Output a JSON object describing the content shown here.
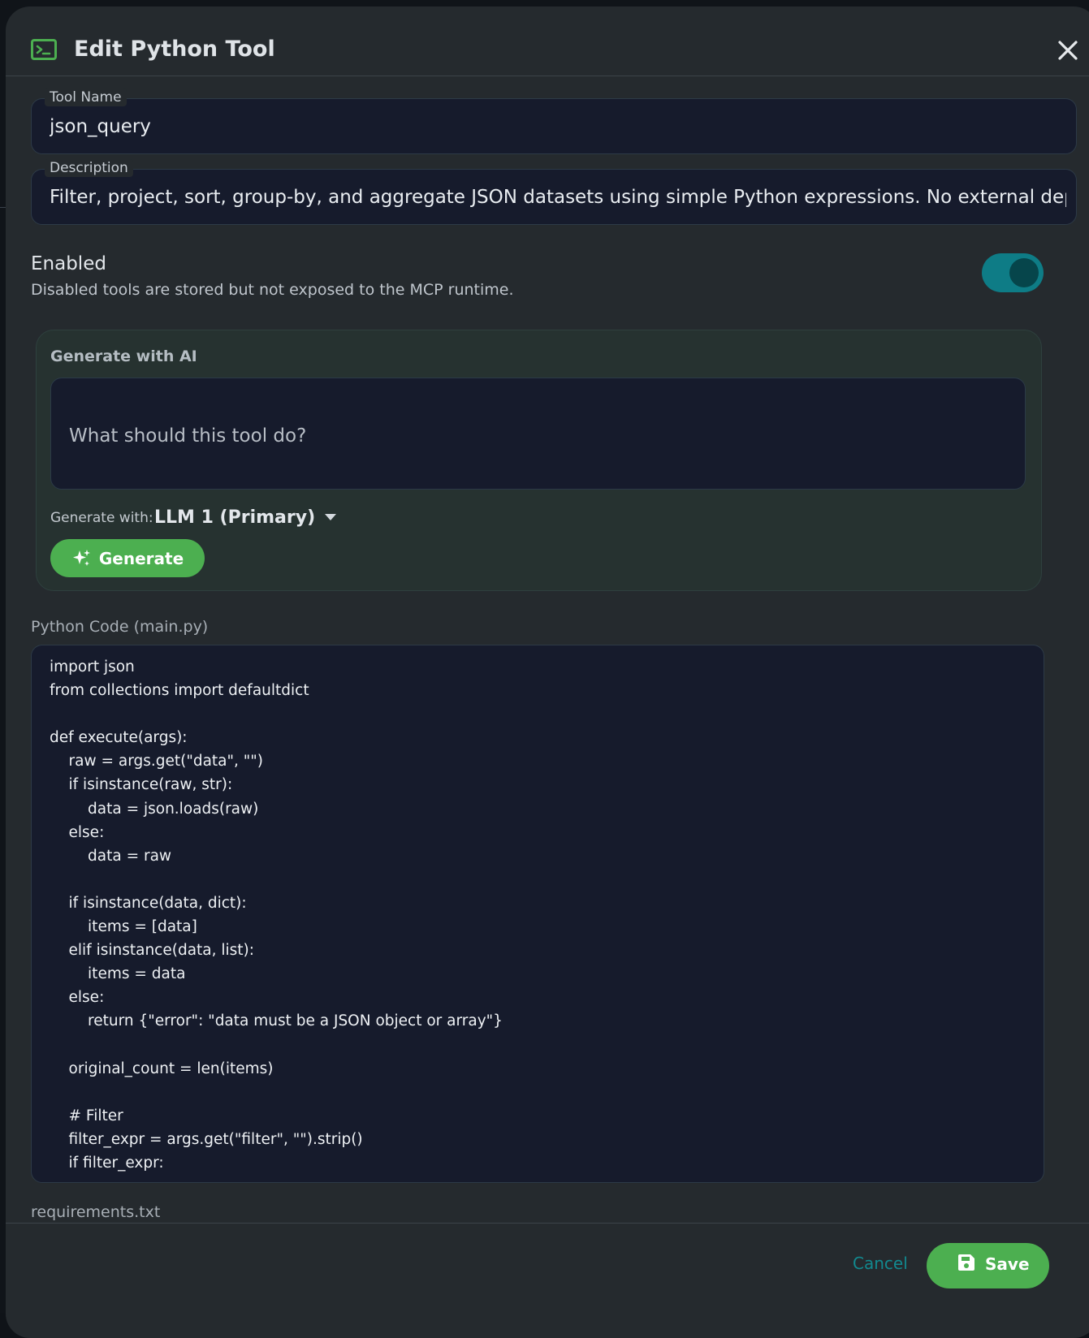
{
  "dialog": {
    "title": "Edit Python Tool",
    "icon": "terminal-icon",
    "close_icon": "close-icon"
  },
  "fields": {
    "tool_name": {
      "label": "Tool Name",
      "value": "json_query"
    },
    "description": {
      "label": "Description",
      "value": "Filter, project, sort, group-by, and aggregate JSON datasets using simple Python expressions. No external dep"
    }
  },
  "enabled": {
    "title": "Enabled",
    "help": "Disabled tools are stored but not exposed to the MCP runtime.",
    "on": true
  },
  "ai": {
    "title": "Generate with AI",
    "prompt_placeholder": "What should this tool do?",
    "generate_with_label": "Generate with:",
    "model": "LLM 1 (Primary)",
    "generate_button": "Generate"
  },
  "code": {
    "label": "Python Code (main.py)",
    "content": "import json\nfrom collections import defaultdict\n\ndef execute(args):\n    raw = args.get(\"data\", \"\")\n    if isinstance(raw, str):\n        data = json.loads(raw)\n    else:\n        data = raw\n\n    if isinstance(data, dict):\n        items = [data]\n    elif isinstance(data, list):\n        items = data\n    else:\n        return {\"error\": \"data must be a JSON object or array\"}\n\n    original_count = len(items)\n\n    # Filter\n    filter_expr = args.get(\"filter\", \"\").strip()\n    if filter_expr:"
  },
  "requirements": {
    "label": "requirements.txt"
  },
  "footer": {
    "cancel": "Cancel",
    "save": "Save"
  },
  "colors": {
    "accent_green": "#4caf50",
    "toggle_teal": "#0e7c86",
    "cancel_teal": "#12898f",
    "panel_bg": "#252a2e",
    "input_bg": "#161b2c"
  }
}
